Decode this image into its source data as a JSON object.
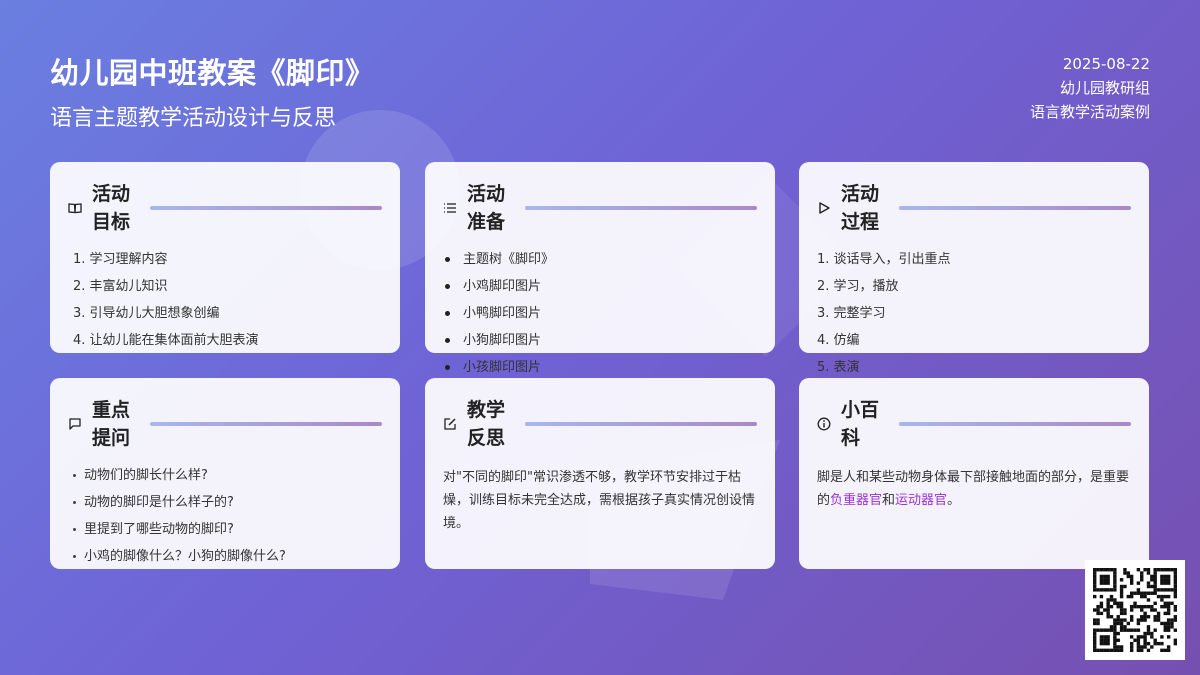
{
  "header": {
    "title": "幼儿园中班教案《脚印》",
    "subtitle": "语言主题教学活动设计与反思"
  },
  "meta": {
    "date": "2025-08-22",
    "group": "幼儿园教研组",
    "category": "语言教学活动案例"
  },
  "cards": {
    "goals": {
      "title_l1": "活动",
      "title_l2": "目标",
      "icon": "book-icon",
      "items": [
        "1. 学习理解内容",
        "2. 丰富幼儿知识",
        "3. 引导幼儿大胆想象创编",
        "4. 让幼儿能在集体面前大胆表演"
      ]
    },
    "prep": {
      "title_l1": "活动",
      "title_l2": "准备",
      "icon": "list-icon",
      "items": [
        "主题树《脚印》",
        "小鸡脚印图片",
        "小鸭脚印图片",
        "小狗脚印图片",
        "小孩脚印图片"
      ]
    },
    "process": {
      "title_l1": "活动",
      "title_l2": "过程",
      "icon": "play-icon",
      "items": [
        "1. 谈话导入，引出重点",
        "2. 学习，播放",
        "3. 完整学习",
        "4. 仿编",
        "5. 表演"
      ]
    },
    "questions": {
      "title_l1": "重点",
      "title_l2": "提问",
      "icon": "chat-bubble-icon",
      "items": [
        "动物们的脚长什么样?",
        "动物的脚印是什么样子的?",
        "里提到了哪些动物的脚印?",
        "小鸡的脚像什么？小狗的脚像什么?"
      ]
    },
    "reflection": {
      "title_l1": "教学",
      "title_l2": "反思",
      "icon": "edit-icon",
      "text": "对\"不同的脚印\"常识渗透不够，教学环节安排过于枯燥，训练目标未完全达成，需根据孩子真实情况创设情境。"
    },
    "wiki": {
      "title_l1": "小百",
      "title_l2": "科",
      "icon": "info-icon",
      "text_a": "脚是人和某些动物身体最下部接触地面的部分，是重要的",
      "hl_1": "负重器官",
      "text_b": "和",
      "hl_2": "运动器官",
      "text_c": "。"
    }
  },
  "colors": {
    "accent": "#9b34d0",
    "bg_start": "#6a7fe0",
    "bg_end": "#7650b0"
  }
}
